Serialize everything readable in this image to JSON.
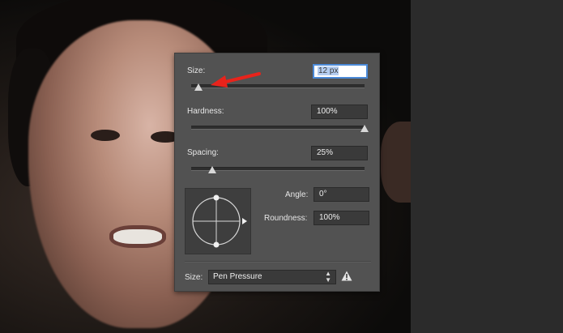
{
  "brush_panel": {
    "size": {
      "label": "Size:",
      "value": "12 px",
      "slider_fraction": 0.04
    },
    "hardness": {
      "label": "Hardness:",
      "value": "100%",
      "slider_fraction": 1.0
    },
    "spacing": {
      "label": "Spacing:",
      "value": "25%",
      "slider_fraction": 0.12
    },
    "angle": {
      "label": "Angle:",
      "value": "0°"
    },
    "roundness": {
      "label": "Roundness:",
      "value": "100%"
    },
    "size_control": {
      "label": "Size:",
      "selected": "Pen Pressure"
    }
  },
  "icons": {
    "warning": "warning-icon",
    "select_arrows": "up-down-arrows-icon",
    "annotation": "red-arrow-annotation"
  },
  "colors": {
    "panel_bg": "#525252",
    "field_bg": "#3a3a3a",
    "focus_ring": "#4b8ad8",
    "annotation_red": "#e8231b"
  }
}
